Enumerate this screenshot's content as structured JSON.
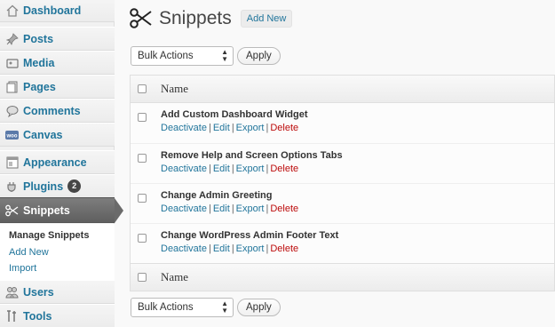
{
  "sidebar": {
    "items": [
      {
        "label": "Dashboard",
        "icon": "home-icon"
      },
      {
        "label": "Posts",
        "icon": "pushpin-icon"
      },
      {
        "label": "Media",
        "icon": "media-icon"
      },
      {
        "label": "Pages",
        "icon": "pages-icon"
      },
      {
        "label": "Comments",
        "icon": "comment-bubble-icon"
      },
      {
        "label": "Canvas",
        "icon": "woo-icon"
      },
      {
        "label": "Appearance",
        "icon": "appearance-icon"
      },
      {
        "label": "Plugins",
        "icon": "plug-icon",
        "badge": "2"
      },
      {
        "label": "Snippets",
        "icon": "scissors-icon"
      },
      {
        "label": "Users",
        "icon": "users-icon"
      },
      {
        "label": "Tools",
        "icon": "tools-icon"
      }
    ],
    "submenu": [
      "Manage Snippets",
      "Add New",
      "Import"
    ]
  },
  "header": {
    "title": "Snippets",
    "add_new": "Add New"
  },
  "bulk": {
    "selected": "Bulk Actions",
    "apply": "Apply"
  },
  "table": {
    "column": "Name",
    "rows": [
      {
        "title": "Add Custom Dashboard Widget"
      },
      {
        "title": "Remove Help and Screen Options Tabs"
      },
      {
        "title": "Change Admin Greeting"
      },
      {
        "title": "Change WordPress Admin Footer Text"
      }
    ],
    "actions": {
      "deactivate": "Deactivate",
      "edit": "Edit",
      "export": "Export",
      "delete": "Delete",
      "sep": "|"
    }
  },
  "colors": {
    "link": "#21759b",
    "delete": "#bc0b0b",
    "active_menu": "#6a6a6a"
  }
}
